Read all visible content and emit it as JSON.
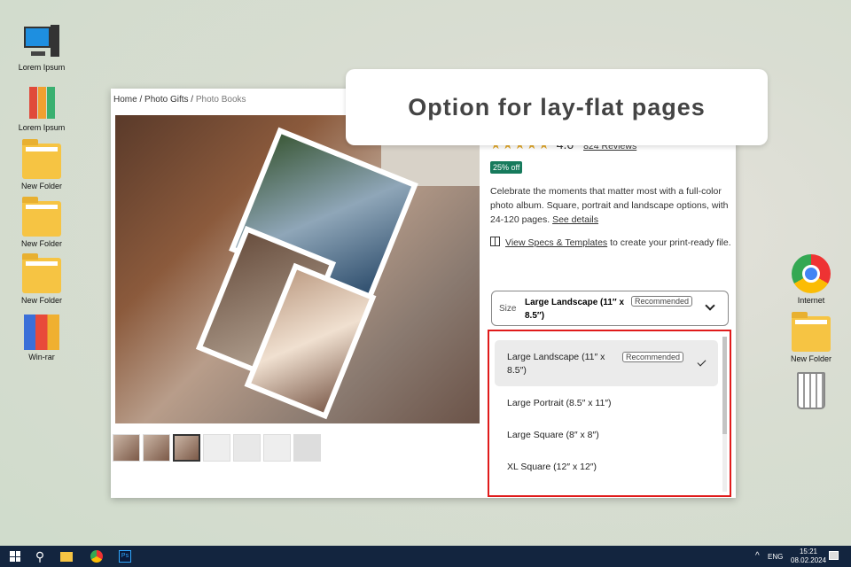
{
  "desktop": {
    "left_icons": [
      "Lorem Ipsum",
      "Lorem Ipsum",
      "New Folder",
      "New Folder",
      "New Folder",
      "Win-rar"
    ],
    "right_icons": [
      "Internet",
      "New Folder",
      ""
    ]
  },
  "callout": "Option for lay-flat pages",
  "breadcrumb": {
    "home": "Home",
    "sep": "/",
    "gifts": "Photo Gifts",
    "current": "Photo Books"
  },
  "product": {
    "stars": "★★★★★",
    "rating": "4.6",
    "reviews": "824 Reviews",
    "badge": "25% off",
    "description": "Celebrate the moments that matter most with a full-color photo album. Square, portrait and landscape options, with 24-120 pages.",
    "see_details": "See details",
    "specs_link": "View Specs & Templates",
    "specs_rest": " to create your print-ready file."
  },
  "size": {
    "label": "Size",
    "value": "Large Landscape (11″ x 8.5″)",
    "tag": "Recommended"
  },
  "options": [
    {
      "label": "Large Landscape (11″ x 8.5″)",
      "tag": "Recommended",
      "selected": true
    },
    {
      "label": "Large Portrait (8.5″ x 11″)"
    },
    {
      "label": "Large Square (8″ x 8″)"
    },
    {
      "label": "XL Square (12″ x 12″)"
    }
  ],
  "taskbar": {
    "lang": "ENG",
    "time": "15:21",
    "date": "08.02.2024"
  },
  "colors": {
    "badge": "#167a5c",
    "highlight": "#e01b1b",
    "taskbar": "#13253f"
  }
}
